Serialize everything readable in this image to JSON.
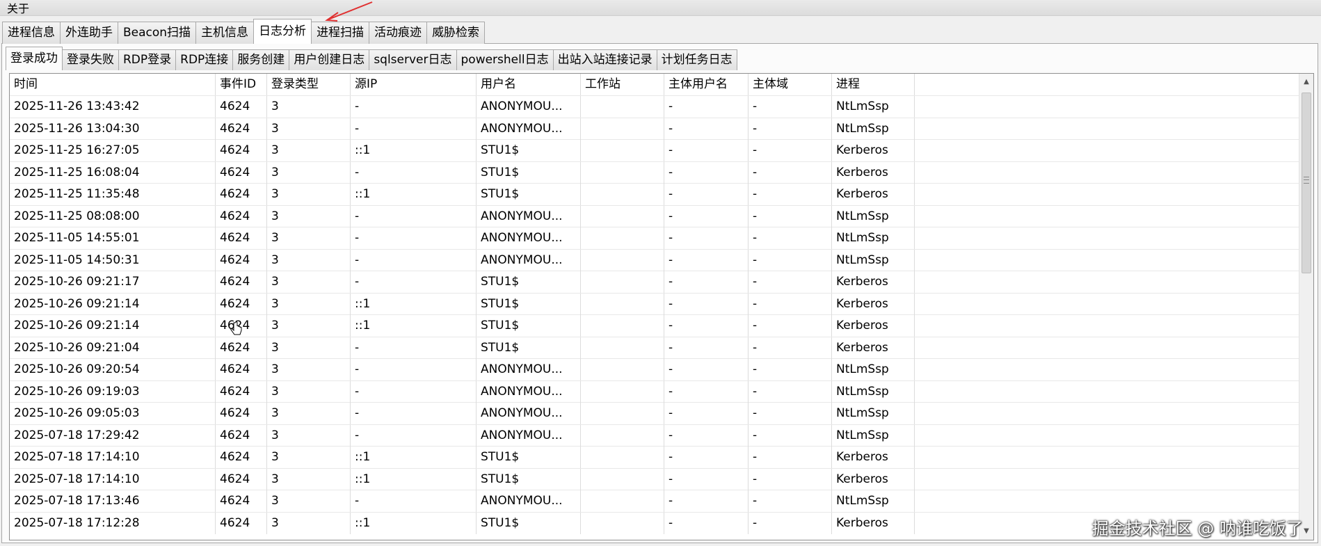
{
  "menu": {
    "about": "关于"
  },
  "main_tabs": [
    {
      "label": "进程信息",
      "active": false
    },
    {
      "label": "外连助手",
      "active": false
    },
    {
      "label": "Beacon扫描",
      "active": false
    },
    {
      "label": "主机信息",
      "active": false
    },
    {
      "label": "日志分析",
      "active": true
    },
    {
      "label": "进程扫描",
      "active": false
    },
    {
      "label": "活动痕迹",
      "active": false
    },
    {
      "label": "威胁检索",
      "active": false
    }
  ],
  "sub_tabs": [
    {
      "label": "登录成功",
      "active": true
    },
    {
      "label": "登录失败",
      "active": false
    },
    {
      "label": "RDP登录",
      "active": false
    },
    {
      "label": "RDP连接",
      "active": false
    },
    {
      "label": "服务创建",
      "active": false
    },
    {
      "label": "用户创建日志",
      "active": false
    },
    {
      "label": "sqlserver日志",
      "active": false
    },
    {
      "label": "powershell日志",
      "active": false
    },
    {
      "label": "出站入站连接记录",
      "active": false
    },
    {
      "label": "计划任务日志",
      "active": false
    }
  ],
  "table": {
    "columns": [
      "时间",
      "事件ID",
      "登录类型",
      "源IP",
      "用户名",
      "工作站",
      "主体用户名",
      "主体域",
      "进程",
      ""
    ],
    "rows": [
      [
        "2025-11-26 13:43:42",
        "4624",
        "3",
        "-",
        "ANONYMOU...",
        "",
        "-",
        "-",
        "NtLmSsp",
        ""
      ],
      [
        "2025-11-26 13:04:30",
        "4624",
        "3",
        "-",
        "ANONYMOU...",
        "",
        "-",
        "-",
        "NtLmSsp",
        ""
      ],
      [
        "2025-11-25 16:27:05",
        "4624",
        "3",
        "::1",
        "STU1$",
        "",
        "-",
        "-",
        "Kerberos",
        ""
      ],
      [
        "2025-11-25 16:08:04",
        "4624",
        "3",
        "-",
        "STU1$",
        "",
        "-",
        "-",
        "Kerberos",
        ""
      ],
      [
        "2025-11-25 11:35:48",
        "4624",
        "3",
        "::1",
        "STU1$",
        "",
        "-",
        "-",
        "Kerberos",
        ""
      ],
      [
        "2025-11-25 08:08:00",
        "4624",
        "3",
        "-",
        "ANONYMOU...",
        "",
        "-",
        "-",
        "NtLmSsp",
        ""
      ],
      [
        "2025-11-05 14:55:01",
        "4624",
        "3",
        "-",
        "ANONYMOU...",
        "",
        "-",
        "-",
        "NtLmSsp",
        ""
      ],
      [
        "2025-11-05 14:50:31",
        "4624",
        "3",
        "-",
        "ANONYMOU...",
        "",
        "-",
        "-",
        "NtLmSsp",
        ""
      ],
      [
        "2025-10-26 09:21:17",
        "4624",
        "3",
        "-",
        "STU1$",
        "",
        "-",
        "-",
        "Kerberos",
        ""
      ],
      [
        "2025-10-26 09:21:14",
        "4624",
        "3",
        "::1",
        "STU1$",
        "",
        "-",
        "-",
        "Kerberos",
        ""
      ],
      [
        "2025-10-26 09:21:14",
        "4624",
        "3",
        "::1",
        "STU1$",
        "",
        "-",
        "-",
        "Kerberos",
        ""
      ],
      [
        "2025-10-26 09:21:04",
        "4624",
        "3",
        "-",
        "STU1$",
        "",
        "-",
        "-",
        "Kerberos",
        ""
      ],
      [
        "2025-10-26 09:20:54",
        "4624",
        "3",
        "-",
        "ANONYMOU...",
        "",
        "-",
        "-",
        "NtLmSsp",
        ""
      ],
      [
        "2025-10-26 09:19:03",
        "4624",
        "3",
        "-",
        "ANONYMOU...",
        "",
        "-",
        "-",
        "NtLmSsp",
        ""
      ],
      [
        "2025-10-26 09:05:03",
        "4624",
        "3",
        "-",
        "ANONYMOU...",
        "",
        "-",
        "-",
        "NtLmSsp",
        ""
      ],
      [
        "2025-07-18 17:29:42",
        "4624",
        "3",
        "-",
        "ANONYMOU...",
        "",
        "-",
        "-",
        "NtLmSsp",
        ""
      ],
      [
        "2025-07-18 17:14:10",
        "4624",
        "3",
        "::1",
        "STU1$",
        "",
        "-",
        "-",
        "Kerberos",
        ""
      ],
      [
        "2025-07-18 17:14:10",
        "4624",
        "3",
        "::1",
        "STU1$",
        "",
        "-",
        "-",
        "Kerberos",
        ""
      ],
      [
        "2025-07-18 17:13:46",
        "4624",
        "3",
        "-",
        "ANONYMOU...",
        "",
        "-",
        "-",
        "NtLmSsp",
        ""
      ],
      [
        "2025-07-18 17:12:28",
        "4624",
        "3",
        "::1",
        "STU1$",
        "",
        "-",
        "-",
        "Kerberos",
        ""
      ]
    ]
  },
  "scrollbar": {
    "up_icon": "▲",
    "down_icon": "▼"
  },
  "watermark": "掘金技术社区 @ 呐谁吃饭了",
  "colors": {
    "annotation_arrow": "#e03030"
  }
}
